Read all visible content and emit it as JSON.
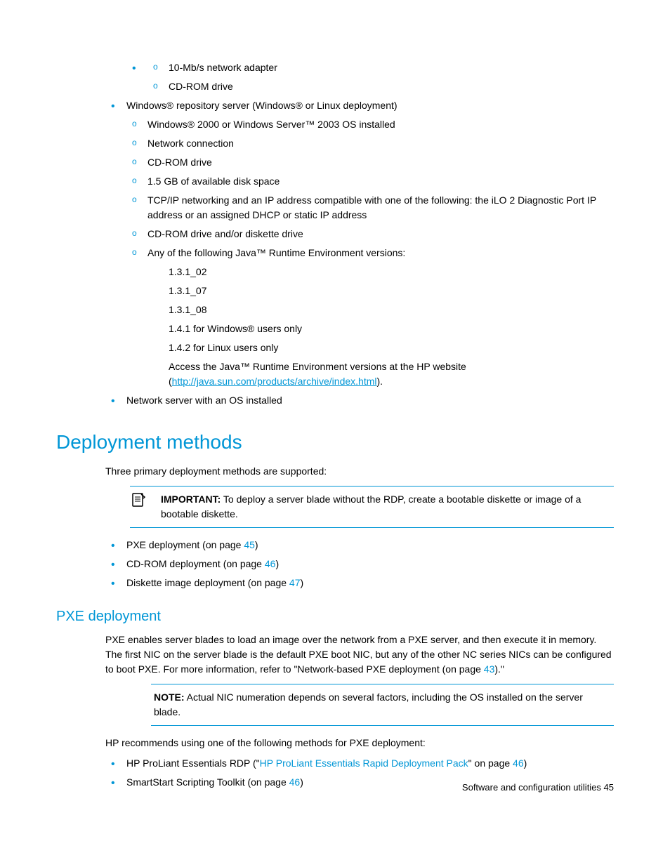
{
  "top_list": {
    "pre_sub": [
      "10-Mb/s network adapter",
      "CD-ROM drive"
    ],
    "item2": "Windows® repository server (Windows® or Linux deployment)",
    "item2_sub": [
      "Windows® 2000 or Windows Server™ 2003 OS installed",
      "Network connection",
      "CD-ROM drive",
      "1.5 GB of available disk space",
      "TCP/IP networking and an IP address compatible with one of the following: the iLO 2 Diagnostic Port IP address or an assigned DHCP or static IP address",
      "CD-ROM drive and/or diskette drive",
      "Any of the following Java™ Runtime Environment versions:"
    ],
    "java_versions": [
      "1.3.1_02",
      "1.3.1_07",
      "1.3.1_08",
      "1.4.1 for Windows® users only",
      "1.4.2 for Linux users only"
    ],
    "java_access_prefix": "Access the Java™ Runtime Environment versions at the HP website (",
    "java_access_link": "http://java.sun.com/products/archive/index.html",
    "java_access_suffix": ").",
    "item3": "Network server with an OS installed"
  },
  "deployment": {
    "heading": "Deployment methods",
    "intro": "Three primary deployment methods are supported:",
    "important_label": "IMPORTANT:",
    "important_text": "  To deploy a server blade without the RDP, create a bootable diskette or image of a bootable diskette.",
    "methods": {
      "m1_pre": "PXE deployment (on page ",
      "m1_page": "45",
      "m1_post": ")",
      "m2_pre": "CD-ROM deployment (on page ",
      "m2_page": "46",
      "m2_post": ")",
      "m3_pre": "Diskette image deployment (on page ",
      "m3_page": "47",
      "m3_post": ")"
    }
  },
  "pxe": {
    "heading": "PXE deployment",
    "para1_pre": "PXE enables server blades to load an image over the network from a PXE server, and then execute it in memory. The first NIC on the server blade is the default PXE boot NIC, but any of the other NC series NICs can be configured to boot PXE. For more information, refer to \"Network-based PXE deployment (on page ",
    "para1_page": "43",
    "para1_post": ").\"",
    "note_label": "NOTE:",
    "note_text": "  Actual NIC numeration depends on several factors, including the OS installed on the server blade.",
    "para2": "HP recommends using one of the following methods for PXE deployment:",
    "rec": {
      "r1_pre": "HP ProLiant Essentials RDP (\"",
      "r1_link": "HP ProLiant Essentials Rapid Deployment Pack",
      "r1_mid": "\" on page ",
      "r1_page": "46",
      "r1_post": ")",
      "r2_pre": "SmartStart Scripting Toolkit (on page ",
      "r2_page": "46",
      "r2_post": ")"
    }
  },
  "footer": {
    "text": "Software and configuration utilities   45"
  }
}
